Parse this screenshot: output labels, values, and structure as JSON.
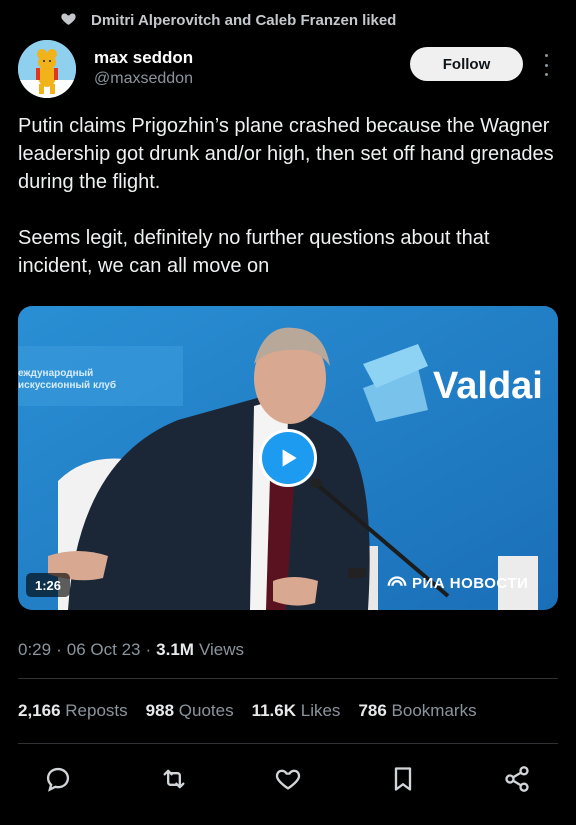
{
  "social_context": {
    "icon": "heart-icon",
    "text": "Dmitri Alperovitch and Caleb Franzen liked"
  },
  "author": {
    "name": "max seddon",
    "handle": "@maxseddon",
    "avatar_icon": "bear-avatar"
  },
  "follow_label": "Follow",
  "more_icon": "more-vertical-icon",
  "tweet": {
    "paragraph1": "Putin claims Prigozhin’s plane crashed because the Wagner leadership got drunk and/or high, then set off hand grenades during the flight.",
    "paragraph2": "Seems legit, definitely no further questions about that incident, we can all move on"
  },
  "media": {
    "duration": "1:26",
    "play_icon": "play-icon",
    "brand_text": "Valdai",
    "banner_line1": "еждународный",
    "banner_line2": "искуссионный клуб",
    "watermark": "РИА НОВОСТИ",
    "accent_color": "#1d9bf0"
  },
  "meta": {
    "time": "0:29",
    "separator": "·",
    "date": "06 Oct 23",
    "views_count": "3.1M",
    "views_label": "Views"
  },
  "stats": [
    {
      "count": "2,166",
      "label": "Reposts"
    },
    {
      "count": "988",
      "label": "Quotes"
    },
    {
      "count": "11.6K",
      "label": "Likes"
    },
    {
      "count": "786",
      "label": "Bookmarks"
    }
  ],
  "actions": [
    "reply-icon",
    "repost-icon",
    "like-icon",
    "bookmark-icon",
    "share-icon"
  ]
}
